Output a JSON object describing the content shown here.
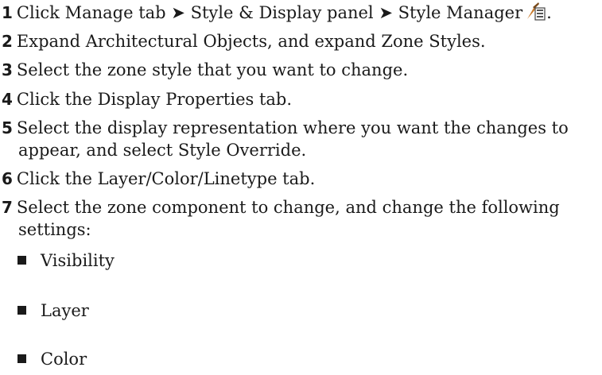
{
  "steps": [
    {
      "num": "1",
      "parts": {
        "a": "Click Manage tab",
        "sep1": "➤",
        "b": "Style & Display panel",
        "sep2": "➤",
        "c": "Style Manager",
        "end": "."
      },
      "icon": "style-manager-icon"
    },
    {
      "num": "2",
      "text": "Expand Architectural Objects, and expand Zone Styles."
    },
    {
      "num": "3",
      "text": "Select the zone style that you want to change."
    },
    {
      "num": "4",
      "text": "Click the Display Properties tab."
    },
    {
      "num": "5",
      "text": "Select the display representation where you want the changes to",
      "cont": "appear, and select Style Override."
    },
    {
      "num": "6",
      "text": "Click the Layer/Color/Linetype tab."
    },
    {
      "num": "7",
      "text": "Select the zone component to change, and change the following",
      "cont": "settings:"
    }
  ],
  "bullets": [
    "Visibility",
    "Layer",
    "Color"
  ]
}
